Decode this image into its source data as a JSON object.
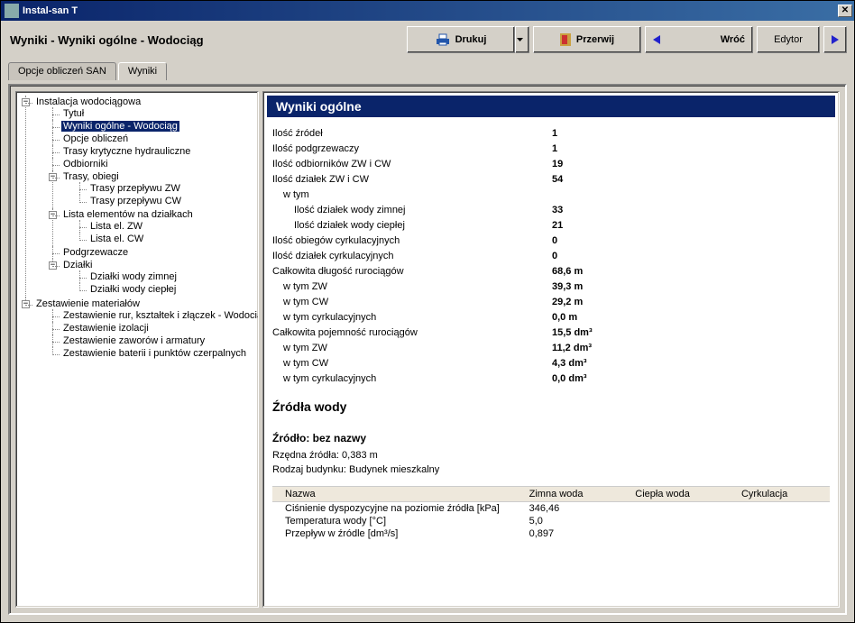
{
  "app": {
    "title": "Instal-san T"
  },
  "breadcrumb": "Wyniki - Wyniki ogólne - Wodociąg",
  "toolbar": {
    "print": "Drukuj",
    "interrupt": "Przerwij",
    "back": "Wróć",
    "editor": "Edytor"
  },
  "tabs": {
    "opts": "Opcje obliczeń SAN",
    "results": "Wyniki"
  },
  "tree": {
    "root": "Instalacja wodociągowa",
    "n_title": "Tytuł",
    "n_wyniki": "Wyniki ogólne - Wodociąg",
    "n_opcje": "Opcje obliczeń",
    "n_trasykh": "Trasy krytyczne hydrauliczne",
    "n_odb": "Odbiorniki",
    "n_trasy": "Trasy, obiegi",
    "n_tzw": "Trasy przepływu ZW",
    "n_tcw": "Trasy przepływu CW",
    "n_lista": "Lista elementów na działkach",
    "n_lzw": "Lista el. ZW",
    "n_lcw": "Lista el. CW",
    "n_podg": "Podgrzewacze",
    "n_dzialki": "Działki",
    "n_dwz": "Działki wody zimnej",
    "n_dwc": "Działki wody ciepłej",
    "n_zest": "Zestawienie materiałów",
    "n_z1": "Zestawienie rur, kształtek i złączek - Wodociąg",
    "n_z2": "Zestawienie izolacji",
    "n_z3": "Zestawienie zaworów i armatury",
    "n_z4": "Zestawienie baterii i punktów czerpalnych"
  },
  "detail": {
    "header": "Wyniki ogólne",
    "rows": [
      {
        "label": "Ilość źródeł",
        "value": "1",
        "indent": 0
      },
      {
        "label": "Ilość podgrzewaczy",
        "value": "1",
        "indent": 0
      },
      {
        "label": "Ilość odbiorników ZW i CW",
        "value": "19",
        "indent": 0
      },
      {
        "label": "Ilość działek ZW i CW",
        "value": "54",
        "indent": 0
      },
      {
        "label": "w tym",
        "value": "",
        "indent": 1
      },
      {
        "label": "Ilość działek wody zimnej",
        "value": "33",
        "indent": 2
      },
      {
        "label": "Ilość działek wody ciepłej",
        "value": "21",
        "indent": 2
      },
      {
        "label": "Ilość obiegów cyrkulacyjnych",
        "value": "0",
        "indent": 0
      },
      {
        "label": "Ilość działek cyrkulacyjnych",
        "value": "0",
        "indent": 0
      },
      {
        "label": "Całkowita długość rurociągów",
        "value": "68,6 m",
        "indent": 0
      },
      {
        "label": "w tym ZW",
        "value": "39,3 m",
        "indent": 1
      },
      {
        "label": "w tym CW",
        "value": "29,2 m",
        "indent": 1
      },
      {
        "label": "w tym cyrkulacyjnych",
        "value": "0,0 m",
        "indent": 1
      },
      {
        "label": "Całkowita pojemność rurociągów",
        "value": "15,5 dm³",
        "indent": 0
      },
      {
        "label": "w tym ZW",
        "value": "11,2 dm³",
        "indent": 1
      },
      {
        "label": "w tym CW",
        "value": "4,3 dm³",
        "indent": 1
      },
      {
        "label": "w tym cyrkulacyjnych",
        "value": "0,0 dm³",
        "indent": 1
      }
    ],
    "sources_hdr": "Źródła wody",
    "source_title": "Źródło: bez nazwy",
    "source_line1": "Rzędna źródła: 0,383 m",
    "source_line2": "Rodzaj budynku: Budynek mieszkalny",
    "table": {
      "h_name": "Nazwa",
      "h_cold": "Zimna woda",
      "h_hot": "Ciepła woda",
      "h_circ": "Cyrkulacja",
      "rows": [
        {
          "name": "Ciśnienie dyspozycyjne na poziomie źródła [kPa]",
          "a": "346,46",
          "b": "",
          "c": ""
        },
        {
          "name": "Temperatura wody [°C]",
          "a": "5,0",
          "b": "",
          "c": ""
        },
        {
          "name": "Przepływ w źródle [dm³/s]",
          "a": "0,897",
          "b": "",
          "c": ""
        }
      ]
    }
  }
}
